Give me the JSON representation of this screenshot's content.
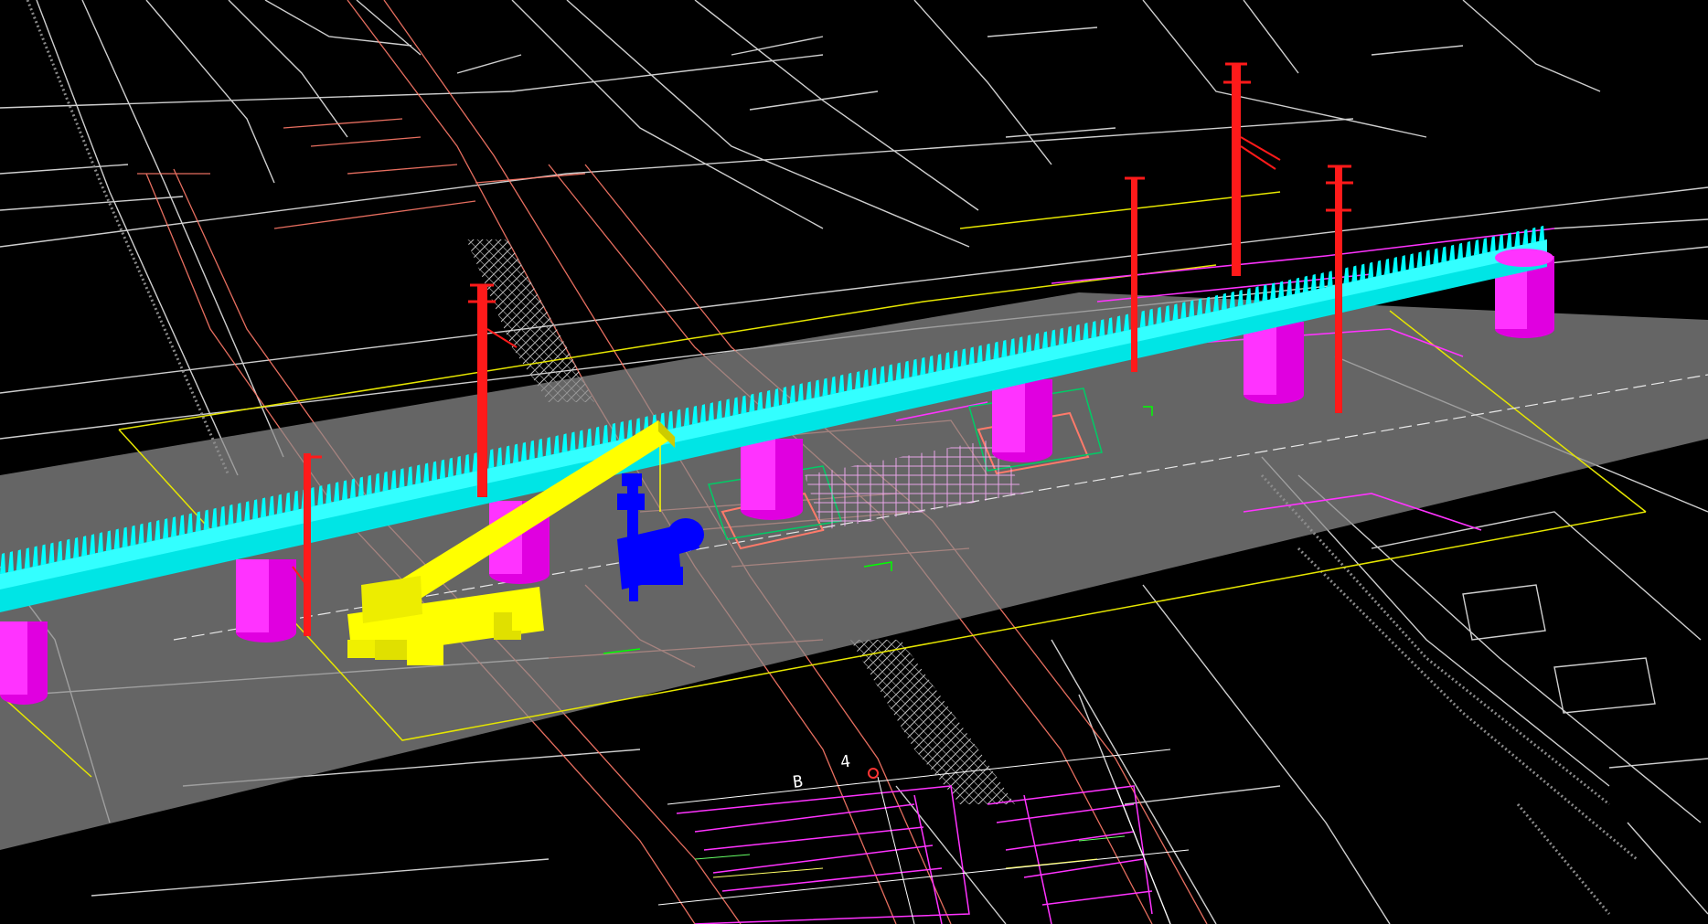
{
  "viewport": {
    "background": "#000000",
    "colors": {
      "map_line": "#cfcfcf",
      "map_line_dim": "#8a8a8a",
      "drainage": "#ff7a6a",
      "road_deck": "#8c8c8c",
      "boundary": "#e6e600",
      "rack_beam": "#00ffff",
      "pier": "#ff00ff",
      "pole": "#ff1a1a",
      "crane": "#ffff00",
      "drill_rig": "#0000ff",
      "hatch": "#d0d0d0",
      "rebar": "#ff66ff"
    },
    "axis_labels": [
      "B",
      "4"
    ],
    "icons": [
      "crane-icon",
      "drill-rig-icon"
    ]
  }
}
